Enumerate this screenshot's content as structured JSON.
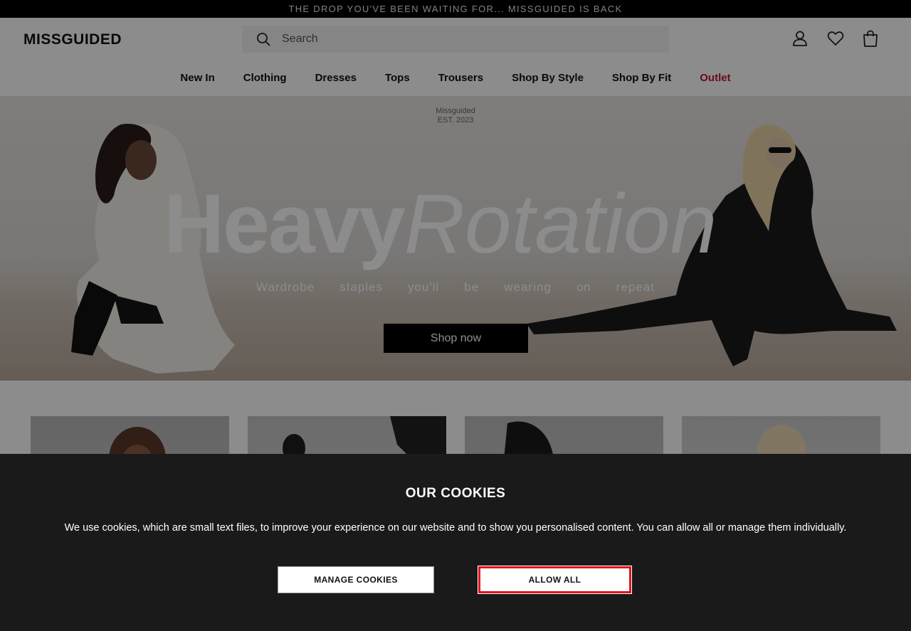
{
  "announcement": "THE DROP YOU'VE BEEN WAITING FOR... MISSGUIDED IS BACK",
  "header": {
    "logo": "MISSGUIDED",
    "search_placeholder": "Search",
    "icons": [
      "user-icon",
      "heart-icon",
      "bag-icon"
    ]
  },
  "nav": {
    "items": [
      {
        "label": "New In"
      },
      {
        "label": "Clothing"
      },
      {
        "label": "Dresses"
      },
      {
        "label": "Tops"
      },
      {
        "label": "Trousers"
      },
      {
        "label": "Shop By Style"
      },
      {
        "label": "Shop By Fit"
      },
      {
        "label": "Outlet"
      }
    ],
    "outlet_color": "#c0182b"
  },
  "hero": {
    "brand": "Missguided",
    "est": "EST. 2023",
    "headline_bold": "Heavy",
    "headline_light": "Rotation",
    "tagline_words": [
      "Wardrobe",
      "staples",
      "you'll",
      "be",
      "wearing",
      "on",
      "repeat"
    ],
    "cta": "Shop now"
  },
  "cookies": {
    "title": "OUR COOKIES",
    "message": "We use cookies, which are small text files, to improve your experience on our website and to show you personalised content. You can allow all or manage them individually.",
    "manage_label": "MANAGE COOKIES",
    "allow_label": "ALLOW ALL",
    "highlight_color": "#e0141c"
  }
}
